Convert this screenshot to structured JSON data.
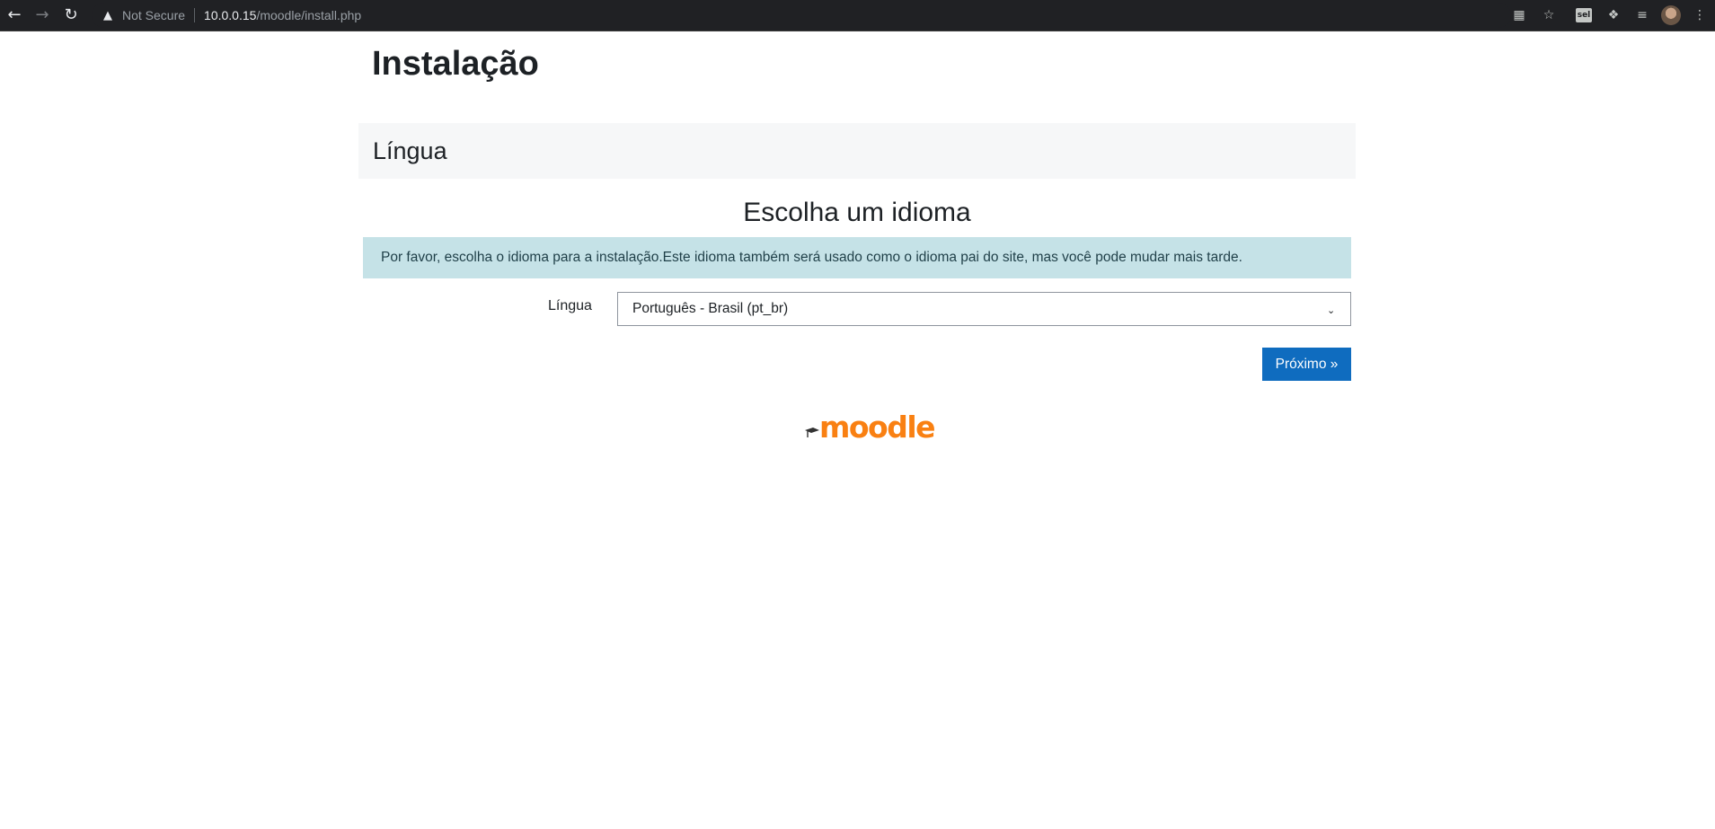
{
  "browser": {
    "security_label": "Not Secure",
    "url_host": "10.0.0.15",
    "url_path": "/moodle/install.php",
    "ext_label": "sel"
  },
  "page": {
    "title": "Instalação",
    "section_title": "Língua",
    "subtitle": "Escolha um idioma",
    "alert": "Por favor, escolha o idioma para a instalação.Este idioma também será usado como o idioma pai do site, mas você pode mudar mais tarde.",
    "language_label": "Língua",
    "language_value": "Português - Brasil (pt_br)",
    "next_button": "Próximo »",
    "logo_text": "moodle"
  },
  "colors": {
    "primary": "#0f6cbf",
    "alert_bg": "#c5e2e7",
    "logo": "#f98012"
  }
}
